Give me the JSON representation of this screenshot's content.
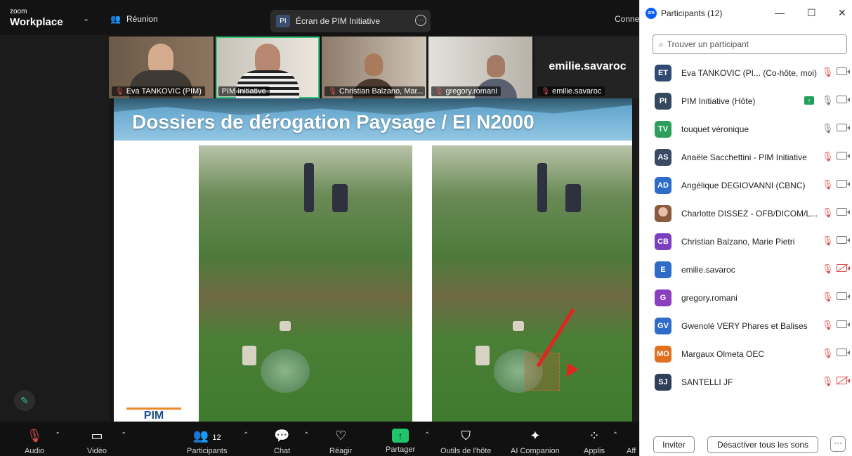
{
  "zoom": {
    "brand_line1": "zoom",
    "brand_line2": "Workplace",
    "meeting_label": "Réunion",
    "share_initials": "PI",
    "share_label": "Écran de PIM Initiative",
    "connection_text": "Conne"
  },
  "thumbnails": [
    {
      "name": "Eva TANKOVIC (PIM)",
      "muted": true
    },
    {
      "name": "PIM Initiative",
      "muted": false,
      "active": true
    },
    {
      "name": "Christian Balzano, Mar...",
      "muted": true
    },
    {
      "name": "gregory.romani",
      "muted": true
    },
    {
      "name": "emilie.savaroc",
      "muted": true,
      "card_name": "emilie.savaroc"
    }
  ],
  "slide": {
    "title": "Dossiers de dérogation Paysage / EI N2000",
    "logo_text": "PIM"
  },
  "toolbar": {
    "audio": "Audio",
    "video": "Vidéo",
    "participants": "Participants",
    "participants_count": "12",
    "chat": "Chat",
    "react": "Réagir",
    "share": "Partager",
    "host_tools": "Outils de l'hôte",
    "ai_companion": "AI Companion",
    "apps": "Applis",
    "more_cut": "Aff"
  },
  "panel": {
    "title": "Participants (12)",
    "search_placeholder": "Trouver un participant",
    "invite": "Inviter",
    "mute_all": "Désactiver tous les sons",
    "participants": [
      {
        "initials": "ET",
        "color": "#2f4a73",
        "name": "Eva TANKOVIC (PI...  (Co-hôte, moi)",
        "mic": "muted",
        "cam": "on"
      },
      {
        "initials": "PI",
        "color": "#34495e",
        "name": "PIM Initiative (Hôte)",
        "mic": "on",
        "cam": "on",
        "sharing": true
      },
      {
        "initials": "TV",
        "color": "#2ca05a",
        "name": "touquet véronique",
        "mic": "on",
        "cam": "on"
      },
      {
        "initials": "AS",
        "color": "#3a4a64",
        "name": "Anaële Sacchettini - PIM Initiative",
        "mic": "muted",
        "cam": "on"
      },
      {
        "initials": "AD",
        "color": "#2d6cc8",
        "name": "Angélique DEGIOVANNI (CBNC)",
        "mic": "muted",
        "cam": "on"
      },
      {
        "initials": "",
        "color": "#b88a6a",
        "name": "Charlotte DISSEZ - OFB/DICOM/L...",
        "mic": "muted",
        "cam": "on",
        "photo": true
      },
      {
        "initials": "CB",
        "color": "#7b3fbf",
        "name": "Christian Balzano, Marie Pietri",
        "mic": "muted",
        "cam": "on"
      },
      {
        "initials": "E",
        "color": "#2d6cc8",
        "name": "emilie.savaroc",
        "mic": "muted",
        "cam": "off"
      },
      {
        "initials": "G",
        "color": "#8a3fbf",
        "name": "gregory.romani",
        "mic": "muted",
        "cam": "on"
      },
      {
        "initials": "GV",
        "color": "#2d6cc8",
        "name": "Gwenolé VERY Phares et Balises",
        "mic": "muted",
        "cam": "on"
      },
      {
        "initials": "MO",
        "color": "#e0701f",
        "name": "Margaux Olmeta OEC",
        "mic": "muted",
        "cam": "on"
      },
      {
        "initials": "SJ",
        "color": "#2f3f59",
        "name": "SANTELLI JF",
        "mic": "muted",
        "cam": "off"
      }
    ]
  }
}
